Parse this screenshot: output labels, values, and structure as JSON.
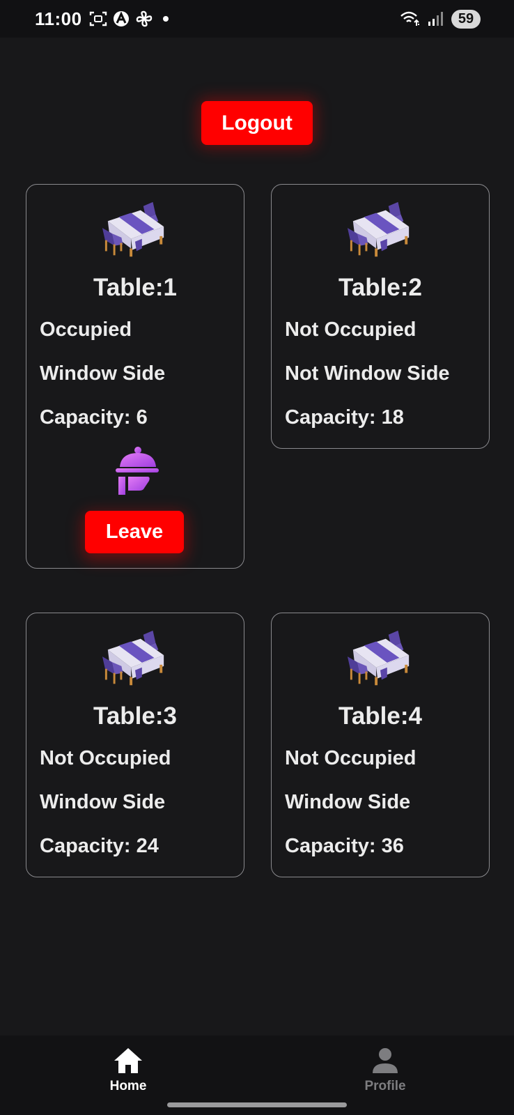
{
  "status_bar": {
    "time": "11:00",
    "battery": "59",
    "left_icons": [
      "screenshot-icon",
      "app-a-icon",
      "fan-icon",
      "notification-dot-icon"
    ],
    "right_icons": [
      "wifi-icon",
      "signal-icon",
      "battery-icon"
    ]
  },
  "header": {
    "logout_label": "Logout"
  },
  "tables": [
    {
      "title": "Table:1",
      "occupancy": "Occupied",
      "location": "Window Side",
      "capacity": "Capacity: 6",
      "icon": "dining-table-icon",
      "action_icon": "waiter-serving-icon",
      "action_label": "Leave"
    },
    {
      "title": "Table:2",
      "occupancy": "Not Occupied",
      "location": "Not Window Side",
      "capacity": "Capacity: 18",
      "icon": "dining-table-icon"
    },
    {
      "title": "Table:3",
      "occupancy": "Not Occupied",
      "location": "Window Side",
      "capacity": "Capacity: 24",
      "icon": "dining-table-icon"
    },
    {
      "title": "Table:4",
      "occupancy": "Not Occupied",
      "location": "Window Side",
      "capacity": "Capacity: 36",
      "icon": "dining-table-icon"
    }
  ],
  "bottom_nav": {
    "items": [
      {
        "label": "Home",
        "icon": "home-icon",
        "active": true
      },
      {
        "label": "Profile",
        "icon": "person-icon",
        "active": false
      }
    ]
  },
  "colors": {
    "background": "#18181a",
    "accent_red": "#ff0000",
    "card_border": "#8a8a8e",
    "table_purple": "#6b56b8",
    "waiter_magenta": "#c84ff0"
  }
}
